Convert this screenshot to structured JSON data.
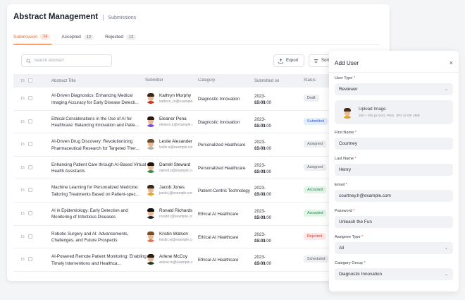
{
  "header": {
    "title": "Abstract Management",
    "breadcrumb": "Submissions"
  },
  "tabs": [
    {
      "label": "Submission",
      "count": "24",
      "active": true
    },
    {
      "label": "Accepted",
      "count": "12",
      "active": false
    },
    {
      "label": "Rejected",
      "count": "12",
      "active": false
    }
  ],
  "toolbar": {
    "search_placeholder": "Search Abstract",
    "export_label": "Export",
    "sort_label": "Sort"
  },
  "table": {
    "columns": {
      "index": "15",
      "title": "Abstract Title",
      "submitter": "Submitter",
      "category": "Category",
      "submitted_on": "Submitted on",
      "status": "Status"
    },
    "rows": [
      {
        "index": "15",
        "title": "AI-Driven Diagnostics: Enhancing Medical Imaging Accuracy for Early Disease Detecti...",
        "name": "Kathryn Murphy",
        "email": "kathryn_m@example.com",
        "category": "Diagnostic Innovation",
        "date": "2023-05-01",
        "time": "12:00:00",
        "status": "Draft",
        "status_class": "st-draft",
        "hair": "#3b2418",
        "shirt": "#c0392b"
      },
      {
        "index": "15",
        "title": "Ethical Considerations in the Use of AI for Healthcare: Balancing Innovation and Patie...",
        "name": "Eleanor Pena",
        "email": "eleanor.p@example.com",
        "category": "Diagnostic Innovation",
        "date": "2023-05-01",
        "time": "12:00:00",
        "status": "Submitted",
        "status_class": "st-submitted",
        "hair": "#2a1a12",
        "shirt": "#7d4bd6"
      },
      {
        "index": "15",
        "title": "AI-Driven Drug Discovery: Revolutionizing Pharmaceutical Research for Targeted Ther...",
        "name": "Leslie Alexander",
        "email": "leslie.a@example.com",
        "category": "Personalized Healthcare",
        "date": "2023-05-01",
        "time": "12:00:00",
        "status": "Assigned",
        "status_class": "st-assigned",
        "hair": "#6b4a2e",
        "shirt": "#b7b2aa"
      },
      {
        "index": "15",
        "title": "Enhancing Patient Care through AI-Based Virtual Health Assistants",
        "name": "Darrell Steward",
        "email": "darrell.s@example.com",
        "category": "Personalized Healthcare",
        "date": "2023-05-01",
        "time": "12:00:00",
        "status": "Assigned",
        "status_class": "st-assigned",
        "hair": "#1e1510",
        "shirt": "#3f8c4a"
      },
      {
        "index": "15",
        "title": "Machine Learning for Personalized Medicine: Tailoring Treatments Based on Patient-spec...",
        "name": "Jacob Jones",
        "email": "jacob.j@example.com",
        "category": "Patient-Centric Technology",
        "date": "2023-05-01",
        "time": "12:00:00",
        "status": "Accepted",
        "status_class": "st-accepted",
        "hair": "#3a2a1c",
        "shirt": "#e0a422"
      },
      {
        "index": "15",
        "title": "AI in Epidemiology: Early Detection and Monitoring of Infectious Diseases",
        "name": "Ronald Richards",
        "email": "ronald.r@example.com",
        "category": "Ethical AI Healthcare",
        "date": "2023-05-01",
        "time": "12:00:00",
        "status": "Accepted",
        "status_class": "st-accepted",
        "hair": "#111111",
        "shirt": "#262626"
      },
      {
        "index": "15",
        "title": "Robotic Surgery and AI: Advancements, Challenges, and Future Prospects",
        "name": "Kristin Watson",
        "email": "kristin.w@example.com",
        "category": "Ethical AI Healthcare",
        "date": "2023-05-01",
        "time": "12:00:00",
        "status": "Rejected",
        "status_class": "st-rejected",
        "hair": "#7a4b2a",
        "shirt": "#e07a52"
      },
      {
        "index": "15",
        "title": "AI-Powered Remote Patient Monitoring: Enabling Timely Interventions and Healthca...",
        "name": "Arlene McCoy",
        "email": "arlene.m@example.com",
        "category": "Ethical AI Healthcare",
        "date": "2023-05-01",
        "time": "12:00:00",
        "status": "Scheduled",
        "status_class": "st-scheduled",
        "hair": "#2a1e16",
        "shirt": "#1f3a2a"
      }
    ]
  },
  "drawer": {
    "title": "Add User",
    "close_icon": "×",
    "user_type": {
      "label": "User Type",
      "value": "Reviewer"
    },
    "upload": {
      "title": "Upload Image",
      "hint": "200 × 200 px SVG, PNG, JPG or GIF 2MB"
    },
    "first_name": {
      "label": "First Name",
      "value": "Courtney"
    },
    "last_name": {
      "label": "Last Name",
      "value": "Henry"
    },
    "email": {
      "label": "Email",
      "value": "courtney.h@example.com"
    },
    "password": {
      "label": "Password",
      "value": "Unleash the Fun"
    },
    "assignee_type": {
      "label": "Assignee Type",
      "value": "All"
    },
    "category_group": {
      "label": "Category Group",
      "value": "Diagnostic Innovation"
    },
    "required_mark": "*"
  }
}
